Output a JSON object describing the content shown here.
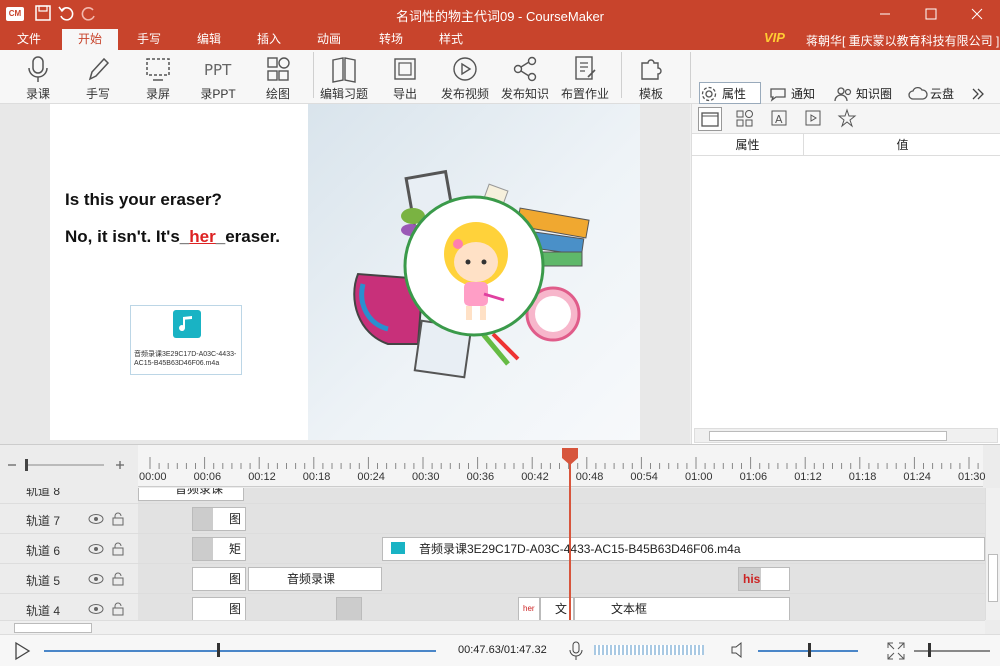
{
  "window": {
    "title": "名词性的物主代词09 - CourseMaker",
    "logo": "CM"
  },
  "menu": {
    "items": [
      "文件",
      "开始",
      "手写",
      "编辑",
      "插入",
      "动画",
      "转场",
      "样式"
    ],
    "active": "开始",
    "vip": "VIP",
    "user": "蒋朝华[ 重庆蒙以教育科技有限公司 ]"
  },
  "toolbar": {
    "tools": [
      {
        "label": "录课",
        "icon": "microphone-icon"
      },
      {
        "label": "手写",
        "icon": "pen-icon"
      },
      {
        "label": "录屏",
        "icon": "screen-record-icon"
      },
      {
        "label": "录PPT",
        "icon": "ppt-icon"
      },
      {
        "label": "绘图",
        "icon": "shapes-icon"
      },
      {
        "label": "编辑习题",
        "icon": "book-icon"
      },
      {
        "label": "导出",
        "icon": "export-icon"
      },
      {
        "label": "发布视频",
        "icon": "play-circle-icon"
      },
      {
        "label": "发布知识",
        "icon": "share-icon"
      },
      {
        "label": "布置作业",
        "icon": "homework-icon"
      },
      {
        "label": "模板",
        "icon": "puzzle-icon"
      }
    ]
  },
  "panel_tabs": [
    {
      "label": "属性",
      "icon": "gear-icon"
    },
    {
      "label": "通知",
      "icon": "chat-icon"
    },
    {
      "label": "知识圈",
      "icon": "group-icon"
    },
    {
      "label": "云盘",
      "icon": "cloud-icon"
    }
  ],
  "slide": {
    "line1": "Is this your eraser?",
    "line2_pre": "No, it isn't. It's_",
    "line2_blank": "her",
    "line2_post": "_eraser.",
    "audio_file": "音频录课3E29C17D-A03C-4433-AC15-B45B63D46F06.m4a"
  },
  "properties": {
    "col_name": "属性",
    "col_value": "值"
  },
  "timeline": {
    "ticks": [
      "00:00",
      "00:06",
      "00:12",
      "00:18",
      "00:24",
      "00:30",
      "00:36",
      "00:42",
      "00:48",
      "00:54",
      "01:00",
      "01:06",
      "01:12",
      "01:18",
      "01:24",
      "01:30"
    ],
    "tracks": [
      {
        "name": "轨道 8",
        "clips": [
          {
            "label": "音频录课"
          }
        ]
      },
      {
        "name": "轨道 7",
        "clips": [
          {
            "label": "图"
          }
        ]
      },
      {
        "name": "轨道 6",
        "clips": [
          {
            "label": "矩"
          },
          {
            "label": "音频录课3E29C17D-A03C-4433-AC15-B45B63D46F06.m4a"
          }
        ]
      },
      {
        "name": "轨道 5",
        "clips": [
          {
            "label": "图"
          },
          {
            "label": "音频录课"
          },
          {
            "label": "his"
          }
        ]
      },
      {
        "name": "轨道 4",
        "clips": [
          {
            "label": "图"
          },
          {
            "label": "her"
          },
          {
            "label": "文"
          },
          {
            "label": "文本框"
          }
        ]
      }
    ]
  },
  "playback": {
    "time": "00:47.63/01:47.32"
  }
}
